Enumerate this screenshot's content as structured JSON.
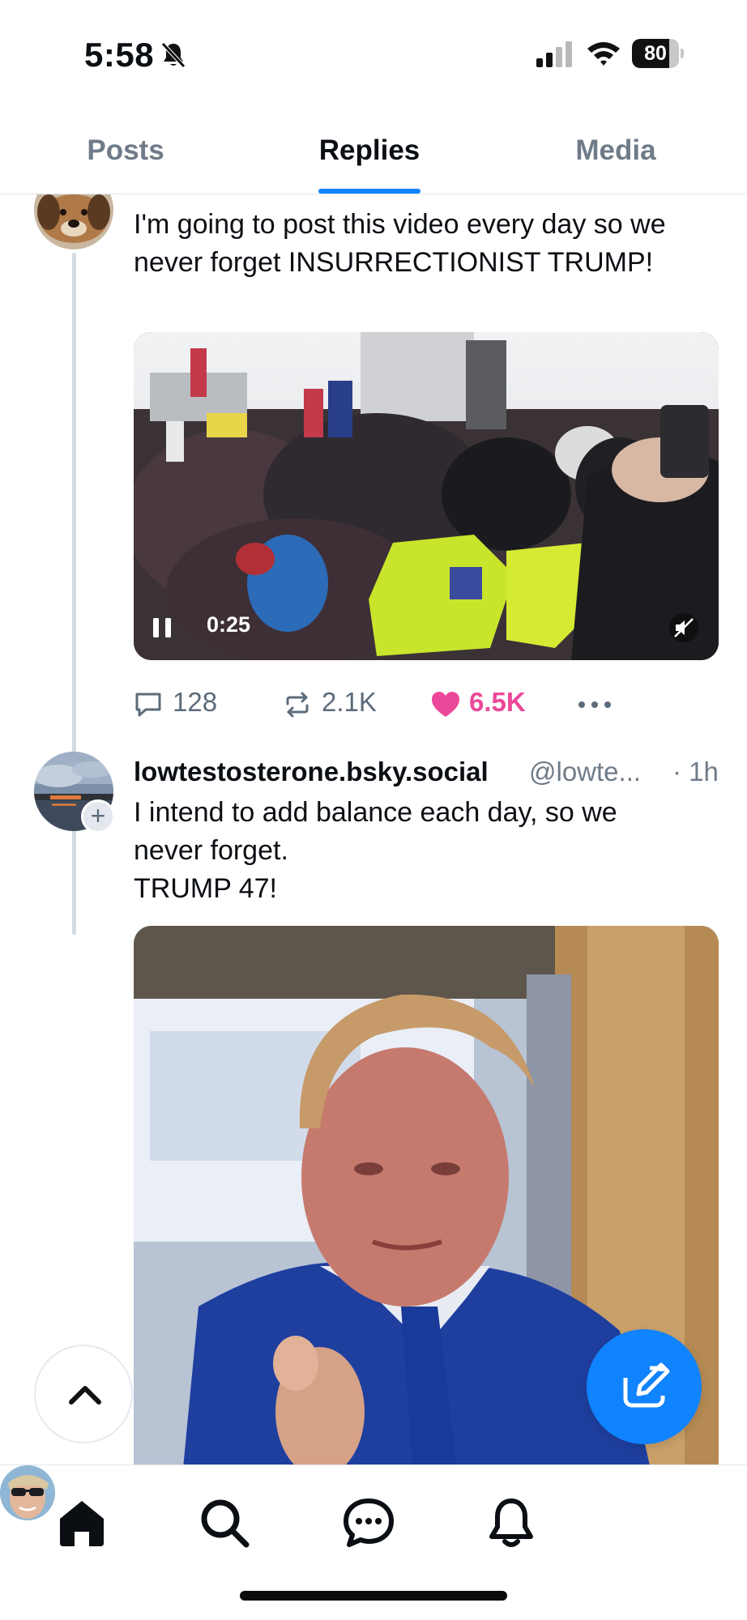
{
  "status_bar": {
    "time": "5:58",
    "battery_percent": "80",
    "battery_level": 0.8
  },
  "tabs": [
    {
      "label": "Posts",
      "selected": false
    },
    {
      "label": "Replies",
      "selected": true
    },
    {
      "label": "Media",
      "selected": false
    }
  ],
  "posts": [
    {
      "text": "I'm going to post this video every day so we never forget INSURRECTIONIST TRUMP!",
      "video": {
        "time": "0:25"
      },
      "stats": {
        "replies": "128",
        "reposts": "2.1K",
        "likes": "6.5K",
        "liked": true
      }
    },
    {
      "author": "lowtestosterone.bsky.social",
      "handle": "@lowte...",
      "time": "· 1h",
      "text": "I intend to add balance each day, so we\nnever forget.\nTRUMP 47!"
    }
  ],
  "nav": {
    "items": [
      "home-icon",
      "search-icon",
      "chat-icon",
      "bell-icon",
      "profile-avatar"
    ]
  },
  "colors": {
    "accent": "#1083fe",
    "like": "#ec4899",
    "muted_text": "#6f7b88",
    "thread_line": "#d4dbe2"
  }
}
